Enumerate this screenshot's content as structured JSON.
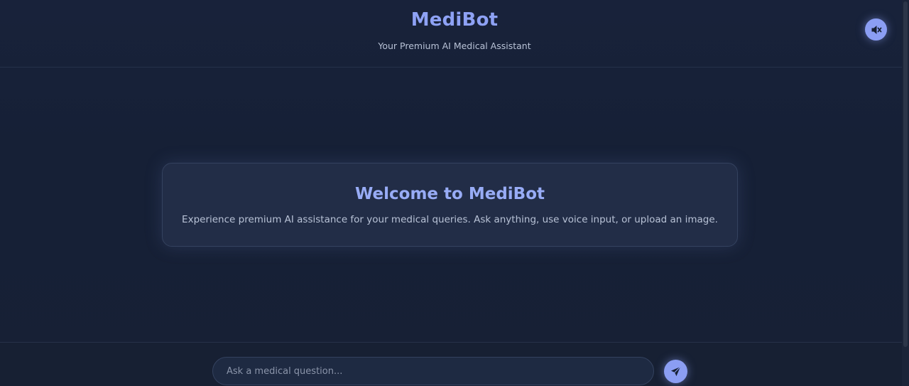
{
  "header": {
    "title": "MediBot",
    "subtitle": "Your Premium AI Medical Assistant",
    "mute_icon": "speaker-mute-icon"
  },
  "welcome": {
    "title": "Welcome to MediBot",
    "text": "Experience premium AI assistance for your medical queries. Ask anything, use voice input, or upload an image."
  },
  "chat": {
    "input_placeholder": "Ask a medical question...",
    "input_value": "",
    "send_icon": "paper-plane-icon"
  },
  "colors": {
    "background": "#172033",
    "accent": "#8b9ef3",
    "title": "#8ea2f5"
  }
}
